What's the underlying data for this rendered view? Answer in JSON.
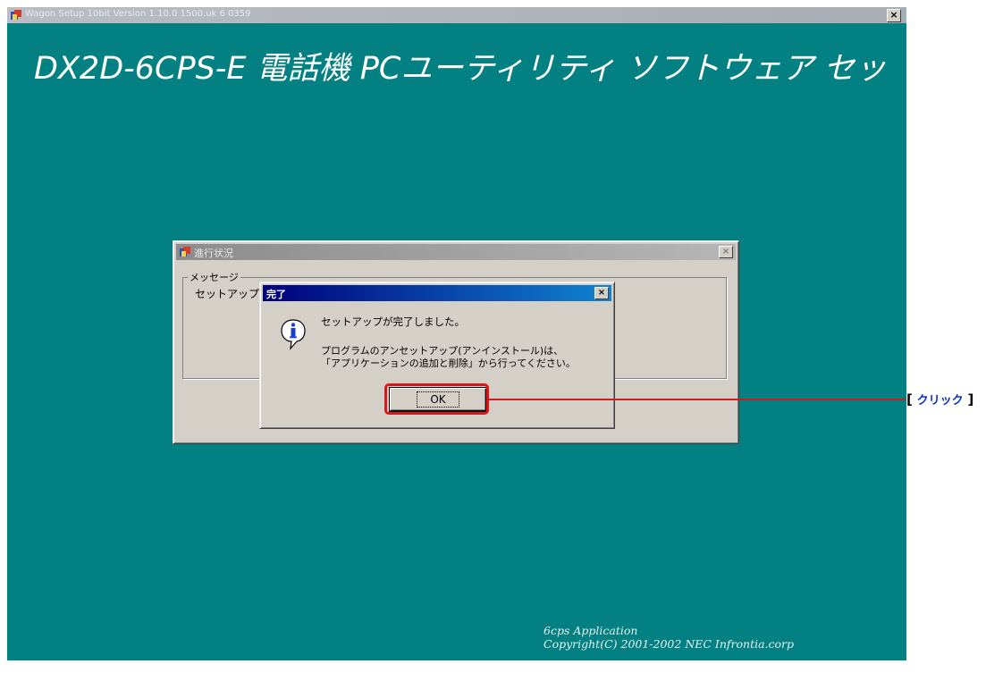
{
  "installer": {
    "title": "Wagon Setup 10bit Version 1.10.0 1500.uk 6 0359",
    "banner": "DX2D-6CPS-E 電話機 PCユーティリティ ソフトウェア セッ",
    "close_symbol": "×",
    "copyright_line1": "6cps Application",
    "copyright_line2": "Copyright(C) 2001-2002 NEC Infrontia.corp",
    "bg_color": "#038182"
  },
  "progress_window": {
    "title": "進行状況",
    "group_label": "メッセージ",
    "message": "セットアップ",
    "close_symbol": "×"
  },
  "complete_dialog": {
    "title": "完了",
    "close_symbol": "×",
    "icon": "info-icon",
    "line1": "セットアップが完了しました。",
    "line2": "プログラムのアンセットアップ(アンインストール)は、",
    "line3": "「アプリケーションの追加と削除」から行ってください。",
    "ok_label": "OK"
  },
  "annotation": {
    "bracket_open": "[",
    "label": "クリック",
    "bracket_close": "]",
    "color": "#e01414",
    "label_color": "#0b2fd0"
  }
}
